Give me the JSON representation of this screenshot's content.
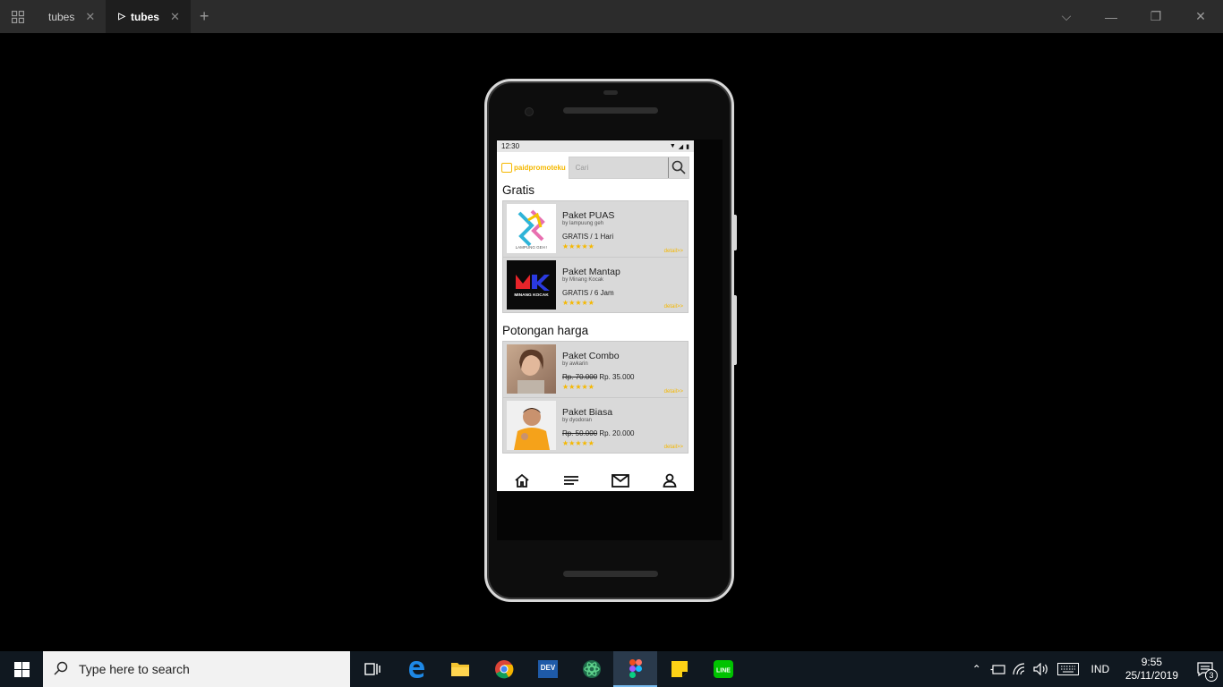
{
  "titlebar": {
    "tabs": [
      {
        "label": "tubes"
      },
      {
        "label": "tubes"
      }
    ]
  },
  "phone": {
    "status": {
      "time": "12:30"
    },
    "app": {
      "logo_text": "paidpromoteku",
      "search_placeholder": "Cari",
      "sections": [
        {
          "title": "Gratis",
          "items": [
            {
              "name": "Paket PUAS",
              "by": "by lampuung geh",
              "price_plain": "GRATIS / 1 Hari",
              "stars": "★★★★★",
              "detail": "detail>>",
              "thumb_text": "LAMPUNG GEH !"
            },
            {
              "name": "Paket Mantap",
              "by": "by Minang Kocak",
              "price_plain": "GRATIS / 6 Jam",
              "stars": "★★★★★",
              "detail": "detail>>",
              "thumb_text": "MINANG KOCAK"
            }
          ]
        },
        {
          "title": "Potongan harga",
          "items": [
            {
              "name": "Paket Combo",
              "by": "by awkarin",
              "price_old": "Rp. 70.000",
              "price_new": " Rp. 35.000",
              "stars": "★★★★★",
              "detail": "detail>>"
            },
            {
              "name": "Paket Biasa",
              "by": "by dyodoran",
              "price_old": "Rp. 50.000",
              "price_new": " Rp. 20.000",
              "stars": "★★★★★",
              "detail": "detail>>"
            }
          ]
        }
      ]
    }
  },
  "taskbar": {
    "search_placeholder": "Type here to search",
    "language": "IND",
    "time": "9:55",
    "date": "25/11/2019",
    "notification_count": "3"
  },
  "colors": {
    "accent": "#f5b800",
    "card_bg": "#d9d9d9"
  }
}
